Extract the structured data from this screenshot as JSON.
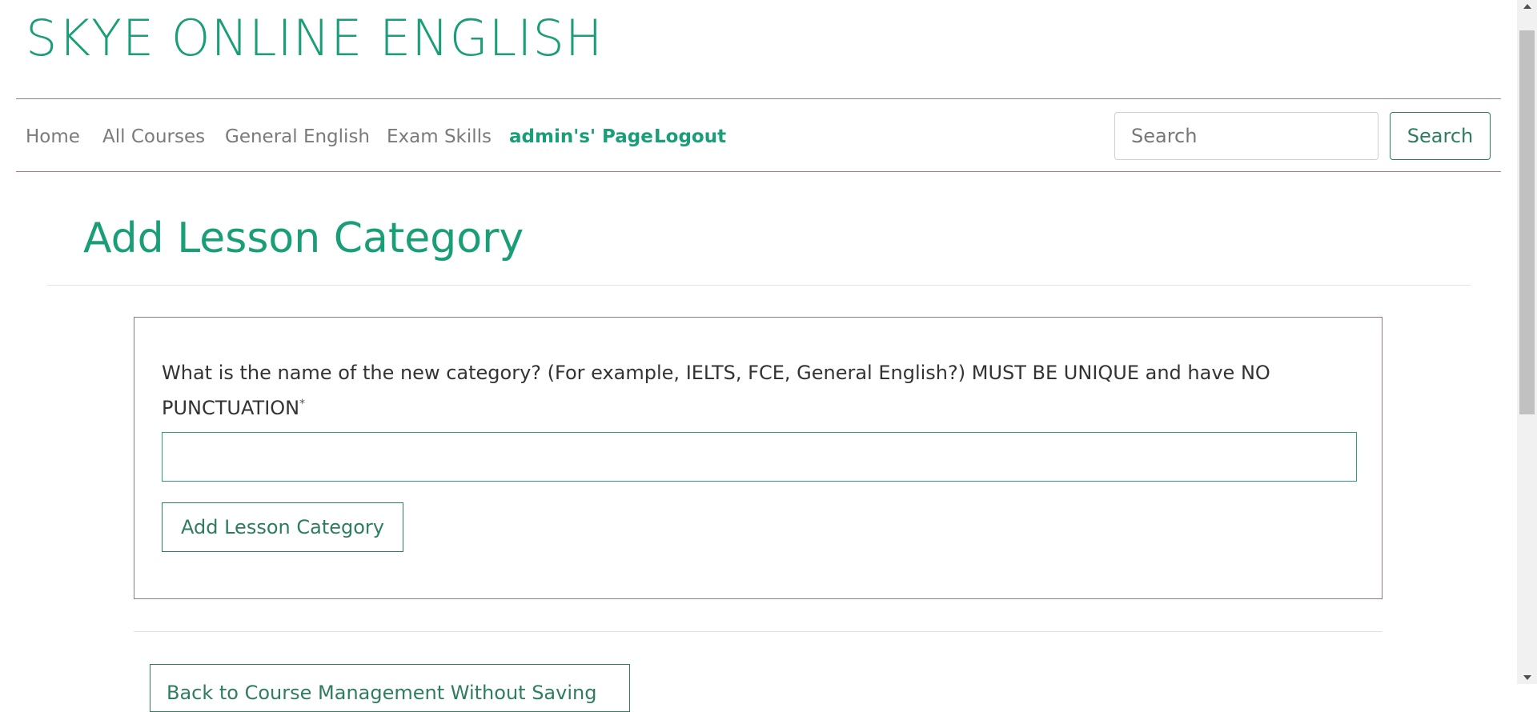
{
  "header": {
    "site_title": "SKYE ONLINE ENGLISH"
  },
  "nav": {
    "links": [
      {
        "label": "Home"
      },
      {
        "label": "All Courses"
      },
      {
        "label": "General English"
      },
      {
        "label": "Exam Skills"
      },
      {
        "label": "admin's' Page"
      },
      {
        "label": "Logout"
      }
    ],
    "search_placeholder": "Search",
    "search_button": "Search"
  },
  "main": {
    "page_title": "Add Lesson Category",
    "form": {
      "label": "What is the name of the new category? (For example, IELTS, FCE, General English?) MUST BE UNIQUE and have NO PUNCTUATION",
      "required_marker": "*",
      "input_value": "",
      "submit_label": "Add Lesson Category"
    },
    "back_button_label": "Back to Course Management Without Saving"
  },
  "colors": {
    "accent": "#1a9e78",
    "button_border": "#2e7d5f",
    "nav_text": "#7a7a7a"
  }
}
